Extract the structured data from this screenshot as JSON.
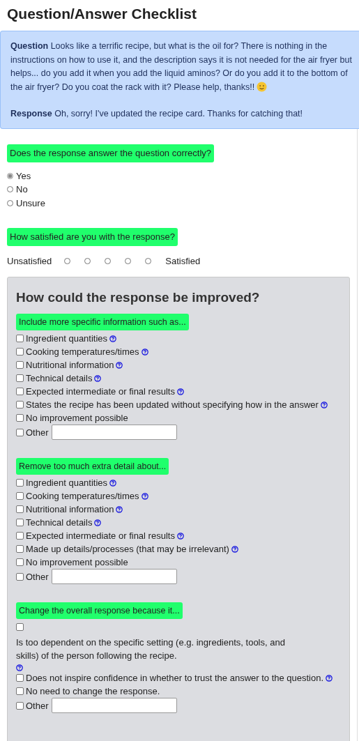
{
  "title": "Question/Answer Checklist",
  "qa": [
    {
      "label": "Question",
      "text": "Looks like a terrific recipe, but what is the oil for? There is nothing in the instructions on how to use it, and the description says it is not needed for the air fryer but helps... do you add it when you add the liquid aminos? Or do you add it to the bottom of the air fryer? Do you coat the rack with it? Please help, thanks!!",
      "smiley": true
    },
    {
      "label": "Response",
      "text": "Oh, sorry! I've updated the recipe card. Thanks for catching that!",
      "smiley": false
    }
  ],
  "correct": {
    "prompt": "Does the response answer the question correctly?",
    "options": [
      {
        "label": "Yes",
        "selected": true
      },
      {
        "label": "No",
        "selected": false
      },
      {
        "label": "Unsure",
        "selected": false
      }
    ]
  },
  "satisfaction": {
    "prompt": "How satisfied are you with the response?",
    "low_label": "Unsatisfied",
    "high_label": "Satisfied",
    "options": [
      {
        "selected": false
      },
      {
        "selected": false
      },
      {
        "selected": false
      },
      {
        "selected": false
      },
      {
        "selected": false
      }
    ]
  },
  "improve": {
    "title": "How could the response be improved?",
    "groups": [
      {
        "prompt": "Include more specific information such as...",
        "items": [
          {
            "kind": "inline",
            "label": "Ingredient quantities",
            "help": true,
            "checked": false
          },
          {
            "kind": "inline",
            "label": "Cooking temperatures/times",
            "help": true,
            "checked": false
          },
          {
            "kind": "inline",
            "label": "Nutritional information",
            "help": true,
            "checked": false
          },
          {
            "kind": "inline",
            "label": "Technical details",
            "help": true,
            "checked": false
          },
          {
            "kind": "inline",
            "label": "Expected intermediate or final results",
            "help": true,
            "checked": false
          },
          {
            "kind": "inline",
            "label": "States the recipe has been updated without specifying how in the answer",
            "help": true,
            "checked": false
          },
          {
            "kind": "inline",
            "label": "No improvement possible",
            "help": false,
            "checked": false
          },
          {
            "kind": "other",
            "label": "Other",
            "help": false,
            "checked": false
          }
        ]
      },
      {
        "prompt": "Remove too much extra detail about...",
        "items": [
          {
            "kind": "inline",
            "label": "Ingredient quantities",
            "help": true,
            "checked": false
          },
          {
            "kind": "inline",
            "label": "Cooking temperatures/times",
            "help": true,
            "checked": false
          },
          {
            "kind": "inline",
            "label": "Nutritional information",
            "help": true,
            "checked": false
          },
          {
            "kind": "inline",
            "label": "Technical details",
            "help": true,
            "checked": false
          },
          {
            "kind": "inline",
            "label": "Expected intermediate or final results",
            "help": true,
            "checked": false
          },
          {
            "kind": "inline",
            "label": "Made up details/processes (that may be irrelevant)",
            "help": true,
            "checked": false
          },
          {
            "kind": "inline",
            "label": "No improvement possible",
            "help": false,
            "checked": false
          },
          {
            "kind": "other",
            "label": "Other",
            "help": false,
            "checked": false
          }
        ]
      },
      {
        "prompt": "Change the overall response because it...",
        "items": [
          {
            "kind": "stacked",
            "label": "Is too dependent on the specific setting (e.g. ingredients, tools, and skills) of the person following the recipe.",
            "help": true,
            "checked": false
          },
          {
            "kind": "inline",
            "label": "Does not inspire confidence in whether to trust the answer to the question.",
            "help": true,
            "checked": false
          },
          {
            "kind": "inline",
            "label": "No need to change the response.",
            "help": false,
            "checked": false
          },
          {
            "kind": "other",
            "label": "Other",
            "help": false,
            "checked": false
          }
        ]
      }
    ]
  }
}
